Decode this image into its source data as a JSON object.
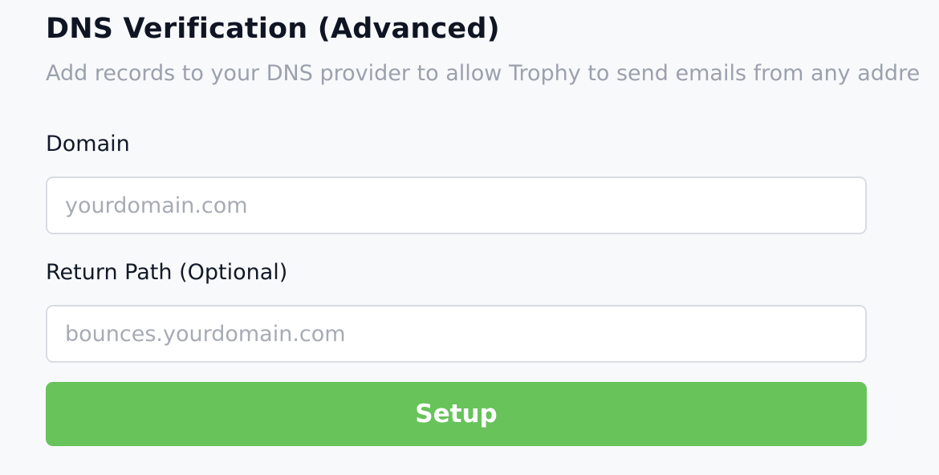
{
  "section": {
    "title": "DNS Verification (Advanced)",
    "subtitle": "Add records to your DNS provider to allow Trophy to send emails from any addre"
  },
  "form": {
    "domain": {
      "label": "Domain",
      "value": "",
      "placeholder": "yourdomain.com"
    },
    "return_path": {
      "label": "Return Path (Optional)",
      "value": "",
      "placeholder": "bounces.yourdomain.com"
    },
    "submit_label": "Setup"
  },
  "colors": {
    "background": "#f8f9fb",
    "title": "#0f1523",
    "subtitle": "#9ba1ad",
    "input_border": "#d9dce2",
    "placeholder": "#a7abb4",
    "button": "#67c35a",
    "button_text": "#ffffff"
  }
}
